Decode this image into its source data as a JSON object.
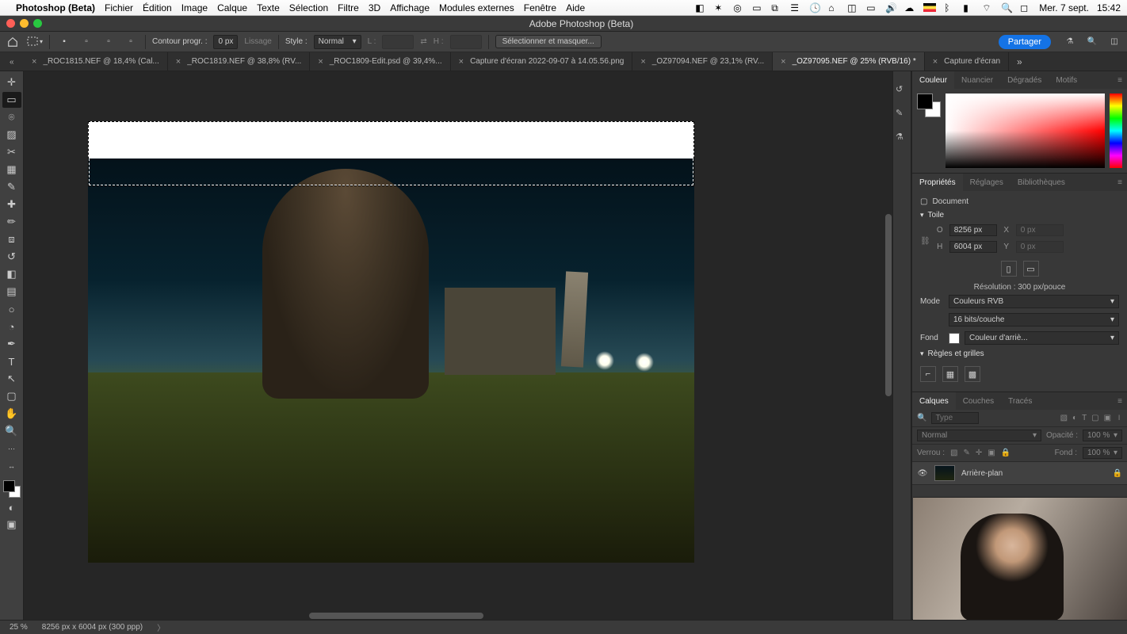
{
  "mac_menu": {
    "app_name": "Photoshop (Beta)",
    "items": [
      "Fichier",
      "Édition",
      "Image",
      "Calque",
      "Texte",
      "Sélection",
      "Filtre",
      "3D",
      "Affichage",
      "Modules externes",
      "Fenêtre",
      "Aide"
    ],
    "date": "Mer. 7 sept.",
    "time": "15:42"
  },
  "window_title": "Adobe Photoshop (Beta)",
  "options_bar": {
    "contour_label": "Contour progr. :",
    "contour_value": "0 px",
    "lissage": "Lissage",
    "style_label": "Style :",
    "style_value": "Normal",
    "l_label": "L :",
    "h_label": "H :",
    "select_mask": "Sélectionner et masquer...",
    "share": "Partager"
  },
  "doc_tabs": [
    {
      "label": "_ROC1815.NEF @ 18,4% (Cal...",
      "active": false
    },
    {
      "label": "_ROC1819.NEF @ 38,8% (RV...",
      "active": false
    },
    {
      "label": "_ROC1809-Edit.psd @ 39,4%...",
      "active": false
    },
    {
      "label": "Capture d'écran 2022-09-07 à 14.05.56.png",
      "active": false
    },
    {
      "label": "_OZ97094.NEF @ 23,1% (RV...",
      "active": false
    },
    {
      "label": "_OZ97095.NEF @ 25% (RVB/16) *",
      "active": true
    },
    {
      "label": "Capture d'écran",
      "active": false
    }
  ],
  "color_panel": {
    "tabs": [
      "Couleur",
      "Nuancier",
      "Dégradés",
      "Motifs"
    ]
  },
  "properties_panel": {
    "tabs": [
      "Propriétés",
      "Réglages",
      "Bibliothèques"
    ],
    "doc_label": "Document",
    "section_toile": "Toile",
    "width_label": "O",
    "width_value": "8256 px",
    "x_label": "X",
    "x_value": "0 px",
    "height_label": "H",
    "height_value": "6004 px",
    "y_label": "Y",
    "y_value": "0 px",
    "resolution": "Résolution : 300 px/pouce",
    "mode_label": "Mode",
    "mode_value": "Couleurs RVB",
    "depth_value": "16 bits/couche",
    "fond_label": "Fond",
    "fond_value": "Couleur d'arriè...",
    "section_rules": "Règles et grilles"
  },
  "layers_panel": {
    "tabs": [
      "Calques",
      "Couches",
      "Tracés"
    ],
    "filter_placeholder": "Type",
    "blend_mode": "Normal",
    "opacity_label": "Opacité :",
    "opacity_value": "100 %",
    "lock_label": "Verrou :",
    "fill_label": "Fond :",
    "fill_value": "100 %",
    "layer_name": "Arrière-plan"
  },
  "status_bar": {
    "zoom": "25 %",
    "dims": "8256 px x 6004 px (300 ppp)"
  }
}
